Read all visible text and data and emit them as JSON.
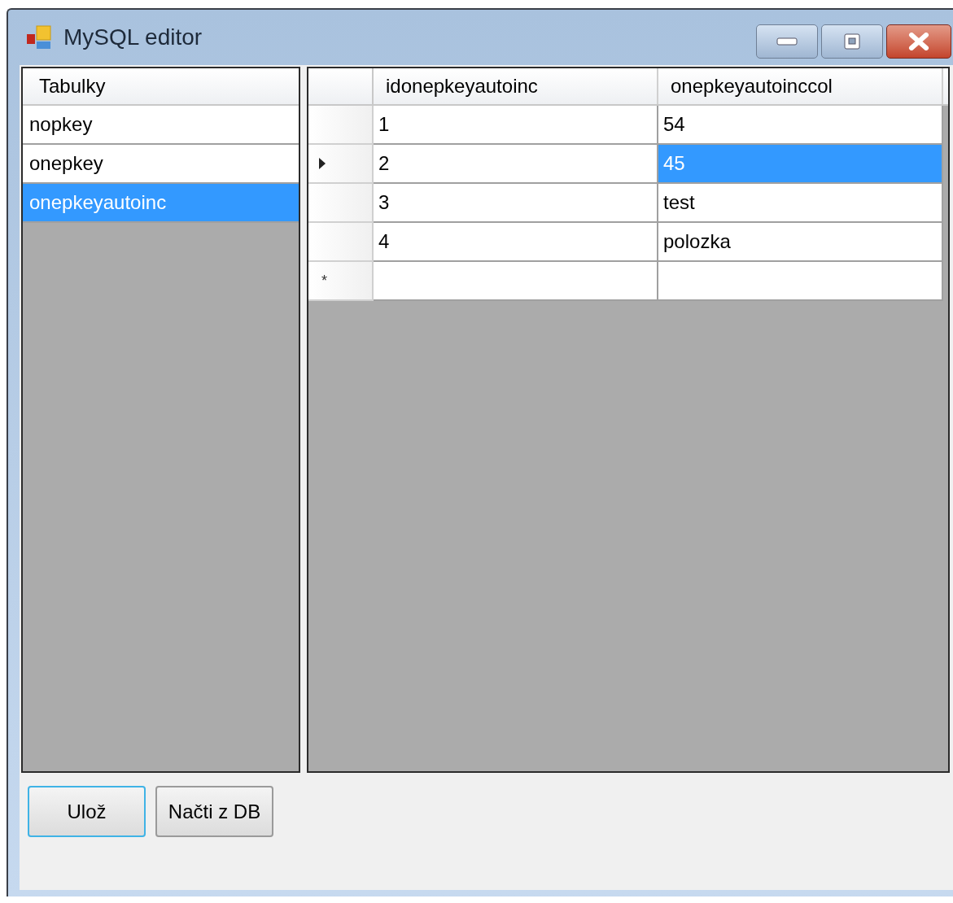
{
  "window": {
    "title": "MySQL editor"
  },
  "tables_list": {
    "header": "Tabulky",
    "items": [
      {
        "label": "nopkey",
        "selected": false
      },
      {
        "label": "onepkey",
        "selected": false
      },
      {
        "label": "onepkeyautoinc",
        "selected": true
      }
    ]
  },
  "grid": {
    "columns": [
      "idonepkeyautoinc",
      "onepkeyautoinccol"
    ],
    "rows": [
      {
        "current": false,
        "cells": [
          {
            "text": "1",
            "selected": false
          },
          {
            "text": "54",
            "selected": false
          }
        ]
      },
      {
        "current": true,
        "cells": [
          {
            "text": "2",
            "selected": false
          },
          {
            "text": "45",
            "selected": true
          }
        ]
      },
      {
        "current": false,
        "cells": [
          {
            "text": "3",
            "selected": false
          },
          {
            "text": "test",
            "selected": false
          }
        ]
      },
      {
        "current": false,
        "cells": [
          {
            "text": "4",
            "selected": false
          },
          {
            "text": "polozka",
            "selected": false
          }
        ]
      }
    ],
    "new_row_marker": "*"
  },
  "buttons": [
    {
      "label": "Ulož",
      "focused": true
    },
    {
      "label": "Načti z DB",
      "focused": false
    }
  ]
}
